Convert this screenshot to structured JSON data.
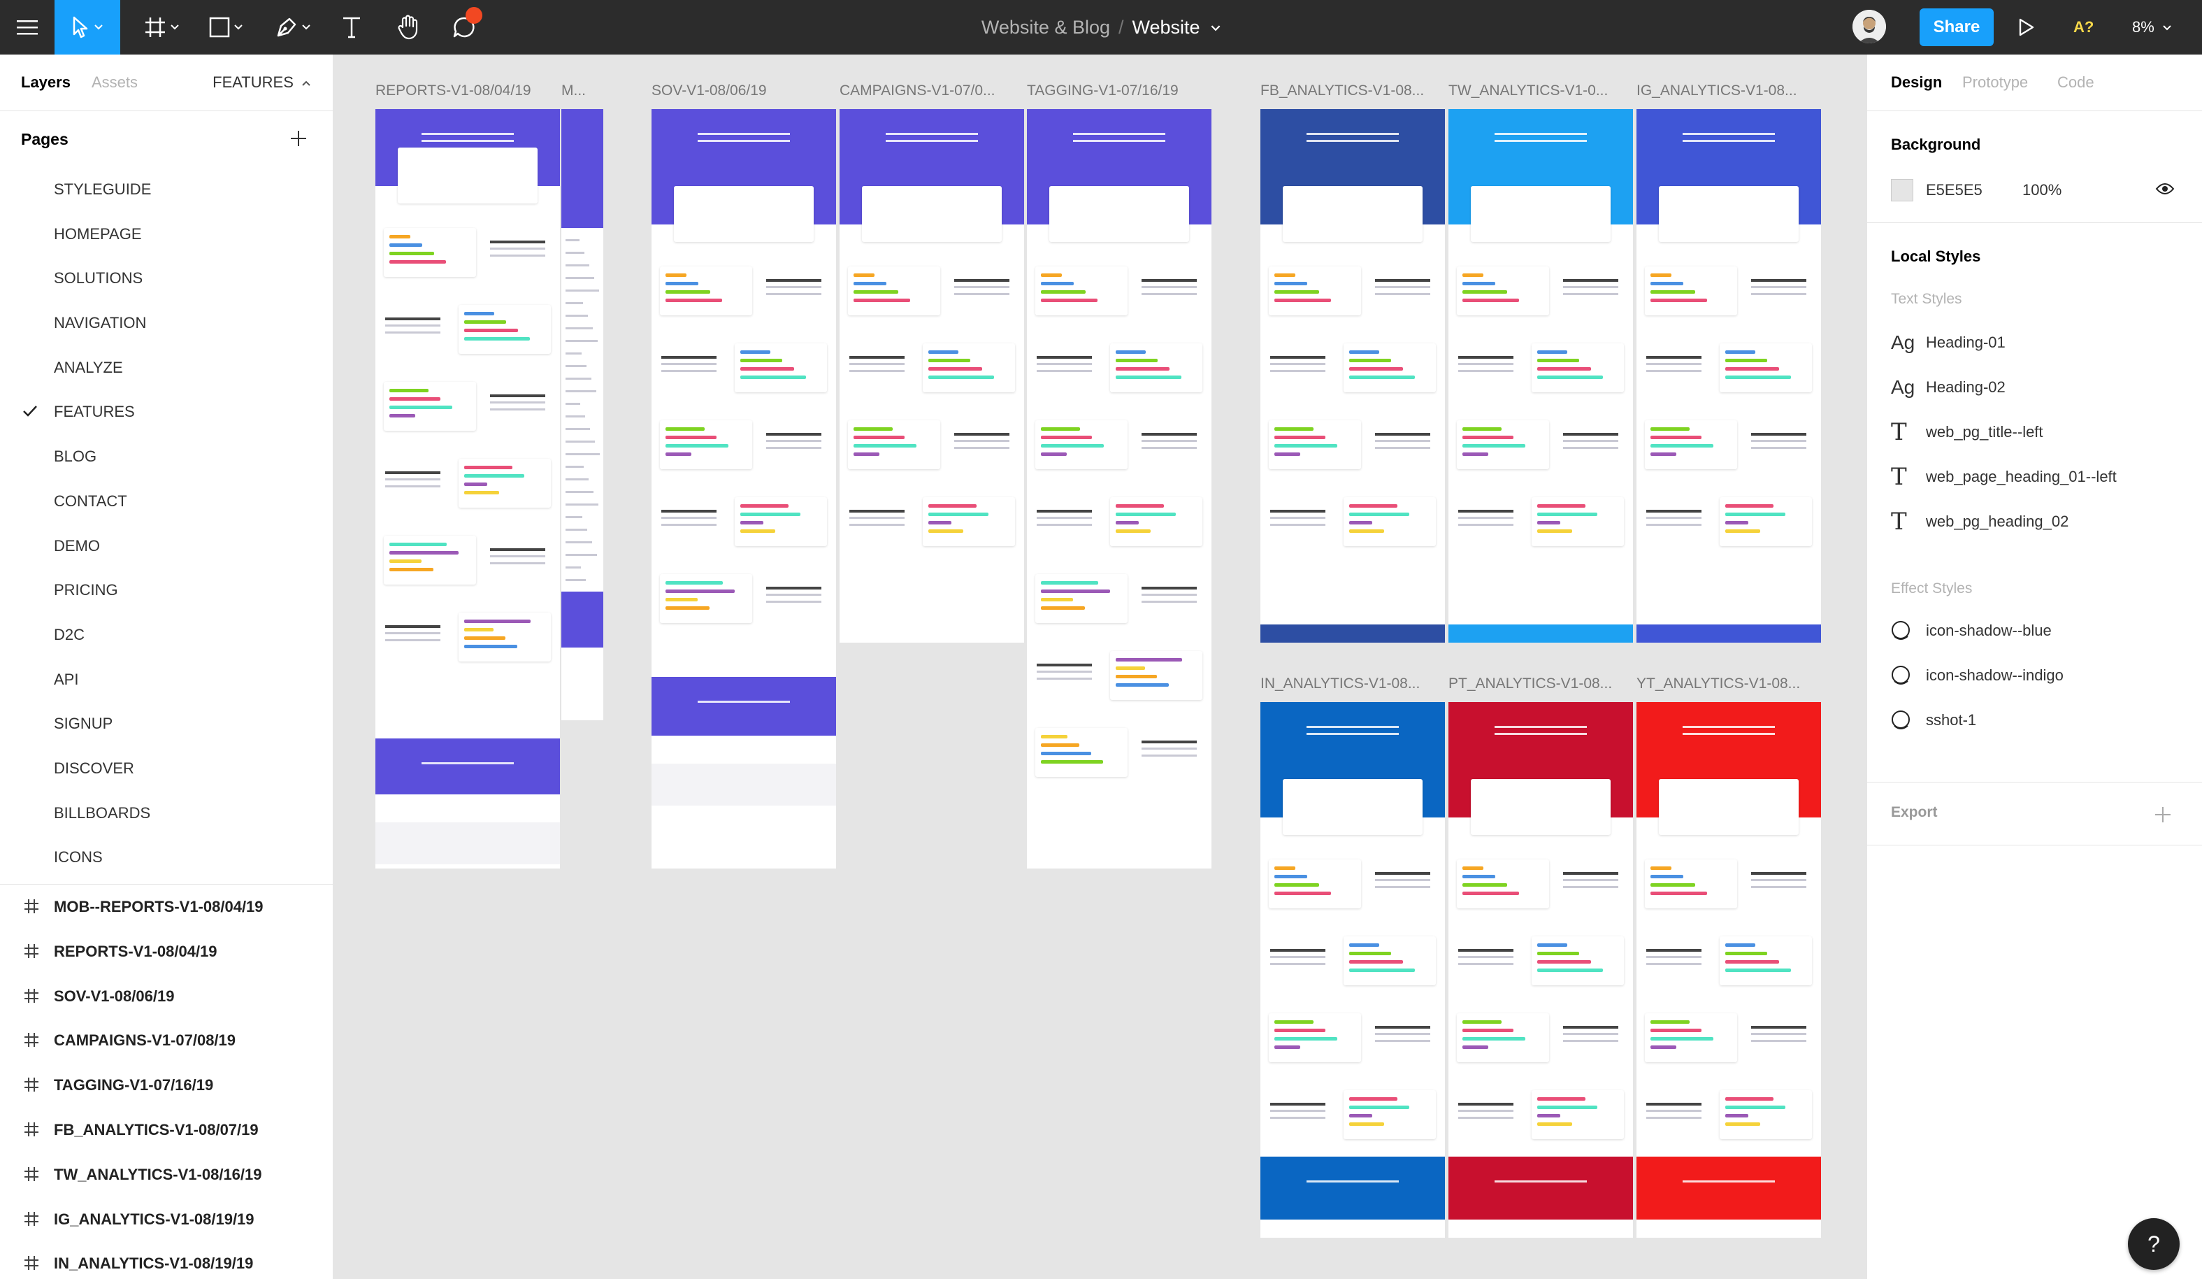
{
  "toolbar": {
    "project_name": "Website & Blog",
    "separator": "/",
    "page_name": "Website",
    "share_label": "Share",
    "font_warning": "A?",
    "zoom": "8%",
    "icons": [
      "menu-icon",
      "move-tool-icon",
      "frame-tool-icon",
      "shape-tool-icon",
      "pen-tool-icon",
      "text-tool-icon",
      "hand-tool-icon",
      "comment-tool-icon",
      "play-icon"
    ]
  },
  "left_panel": {
    "tab_layers": "Layers",
    "tab_assets": "Assets",
    "current_page_switch": "FEATURES",
    "pages_title": "Pages",
    "pages": [
      {
        "label": "STYLEGUIDE",
        "selected": false
      },
      {
        "label": "HOMEPAGE",
        "selected": false
      },
      {
        "label": "SOLUTIONS",
        "selected": false
      },
      {
        "label": "NAVIGATION",
        "selected": false
      },
      {
        "label": "ANALYZE",
        "selected": false
      },
      {
        "label": "FEATURES",
        "selected": true
      },
      {
        "label": "BLOG",
        "selected": false
      },
      {
        "label": "CONTACT",
        "selected": false
      },
      {
        "label": "DEMO",
        "selected": false
      },
      {
        "label": "PRICING",
        "selected": false
      },
      {
        "label": "D2C",
        "selected": false
      },
      {
        "label": "API",
        "selected": false
      },
      {
        "label": "SIGNUP",
        "selected": false
      },
      {
        "label": "DISCOVER",
        "selected": false
      },
      {
        "label": "BILLBOARDS",
        "selected": false
      },
      {
        "label": "ICONS",
        "selected": false
      }
    ],
    "layers": [
      "MOB--REPORTS-V1-08/04/19",
      "REPORTS-V1-08/04/19",
      "SOV-V1-08/06/19",
      "CAMPAIGNS-V1-07/08/19",
      "TAGGING-V1-07/16/19",
      "FB_ANALYTICS-V1-08/07/19",
      "TW_ANALYTICS-V1-08/16/19",
      "IG_ANALYTICS-V1-08/19/19",
      "IN_ANALYTICS-V1-08/19/19"
    ]
  },
  "right_panel": {
    "tab_design": "Design",
    "tab_prototype": "Prototype",
    "tab_code": "Code",
    "background_title": "Background",
    "background_hex": "E5E5E5",
    "background_opacity": "100%",
    "local_styles_title": "Local Styles",
    "text_styles_title": "Text Styles",
    "text_styles": [
      {
        "icon": "Ag",
        "label": "Heading-01"
      },
      {
        "icon": "Ag",
        "label": "Heading-02"
      },
      {
        "icon": "T",
        "label": "web_pg_title--left"
      },
      {
        "icon": "T",
        "label": "web_page_heading_01--left"
      },
      {
        "icon": "T",
        "label": "web_pg_heading_02"
      }
    ],
    "effect_styles_title": "Effect Styles",
    "effect_styles": [
      {
        "label": "icon-shadow--blue"
      },
      {
        "label": "icon-shadow--indigo"
      },
      {
        "label": "sshot-1"
      }
    ],
    "export_title": "Export"
  },
  "canvas": {
    "frames": [
      {
        "label": "REPORTS-V1-08/04/19",
        "accent": "#5b4fdb"
      },
      {
        "label": "M...",
        "accent": "#5b4fdb"
      },
      {
        "label": "SOV-V1-08/06/19",
        "accent": "#5b4fdb"
      },
      {
        "label": "CAMPAIGNS-V1-07/0...",
        "accent": "#5b4fdb"
      },
      {
        "label": "TAGGING-V1-07/16/19",
        "accent": "#5b4fdb"
      },
      {
        "label": "FB_ANALYTICS-V1-08...",
        "accent": "#2d4ea3"
      },
      {
        "label": "TW_ANALYTICS-V1-0...",
        "accent": "#1da1f2"
      },
      {
        "label": "IG_ANALYTICS-V1-08...",
        "accent": "#4056d6"
      },
      {
        "label": "IN_ANALYTICS-V1-08...",
        "accent": "#0a66c2"
      },
      {
        "label": "PT_ANALYTICS-V1-08...",
        "accent": "#c8102e"
      },
      {
        "label": "YT_ANALYTICS-V1-08...",
        "accent": "#f21b1b"
      }
    ]
  },
  "help_label": "?",
  "colors": {
    "toolbar_bg": "#2c2c2c",
    "active_blue": "#18a0fb",
    "canvas_bg": "#e5e5e5",
    "notification_red": "#f24822"
  }
}
